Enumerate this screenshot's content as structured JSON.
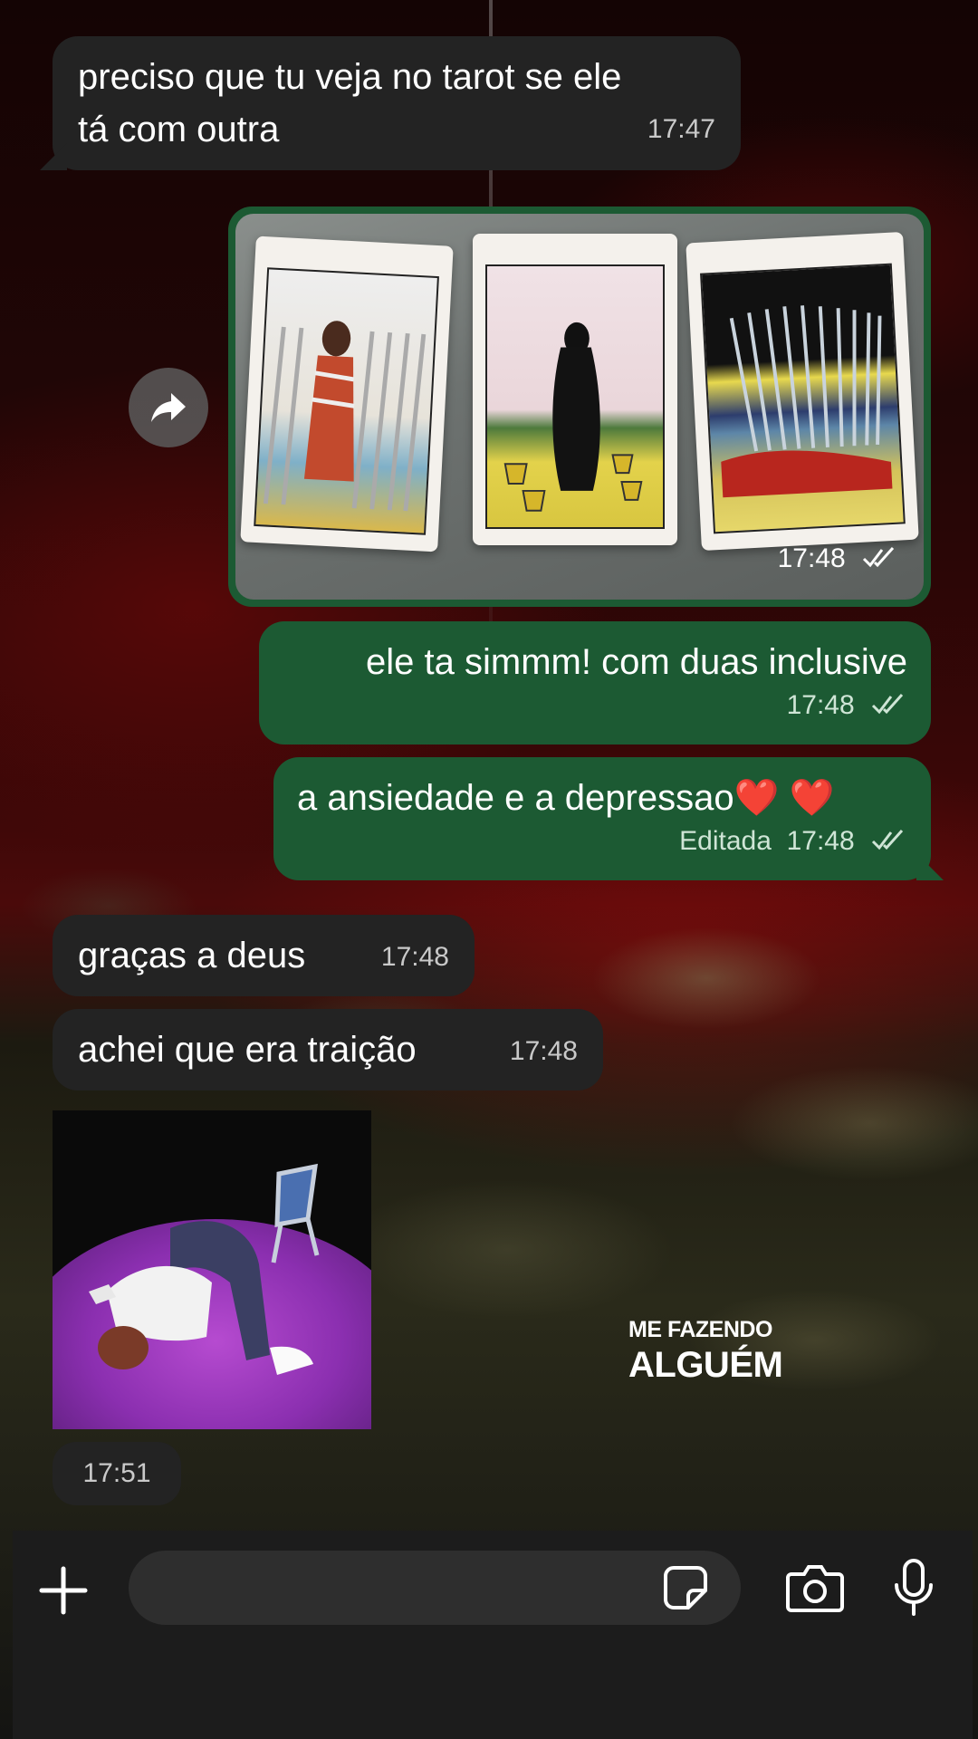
{
  "messages": [
    {
      "direction": "incoming",
      "text": "preciso que tu veja no tarot se ele tá com outra",
      "time": "17:47"
    },
    {
      "direction": "outgoing",
      "type": "image",
      "image_content": "three tarot cards: VIII, V, X",
      "card_numerals": [
        "VIII",
        "V",
        "X"
      ],
      "time": "17:48",
      "status": "read"
    },
    {
      "direction": "outgoing",
      "text": "ele ta simmm! com duas inclusive",
      "time": "17:48",
      "status": "read"
    },
    {
      "direction": "outgoing",
      "text": "a ansiedade e a depressao",
      "emoji": "❤️ ❤️",
      "edited_label": "Editada",
      "time": "17:48",
      "status": "read"
    },
    {
      "direction": "incoming",
      "text": "graças a deus",
      "time": "17:48"
    },
    {
      "direction": "incoming",
      "text": "achei que era traição",
      "time": "17:48"
    },
    {
      "direction": "incoming",
      "type": "sticker",
      "time": "17:51"
    }
  ],
  "watermark": {
    "line1": "ME FAZENDO",
    "line2": "ALGUÉM"
  },
  "composer": {
    "placeholder": "",
    "icons": [
      "plus-icon",
      "sticker-icon",
      "camera-icon",
      "microphone-icon"
    ]
  },
  "colors": {
    "outgoing_bubble": "#1c5a33",
    "incoming_bubble": "#232323",
    "heart": "#e0182a"
  }
}
